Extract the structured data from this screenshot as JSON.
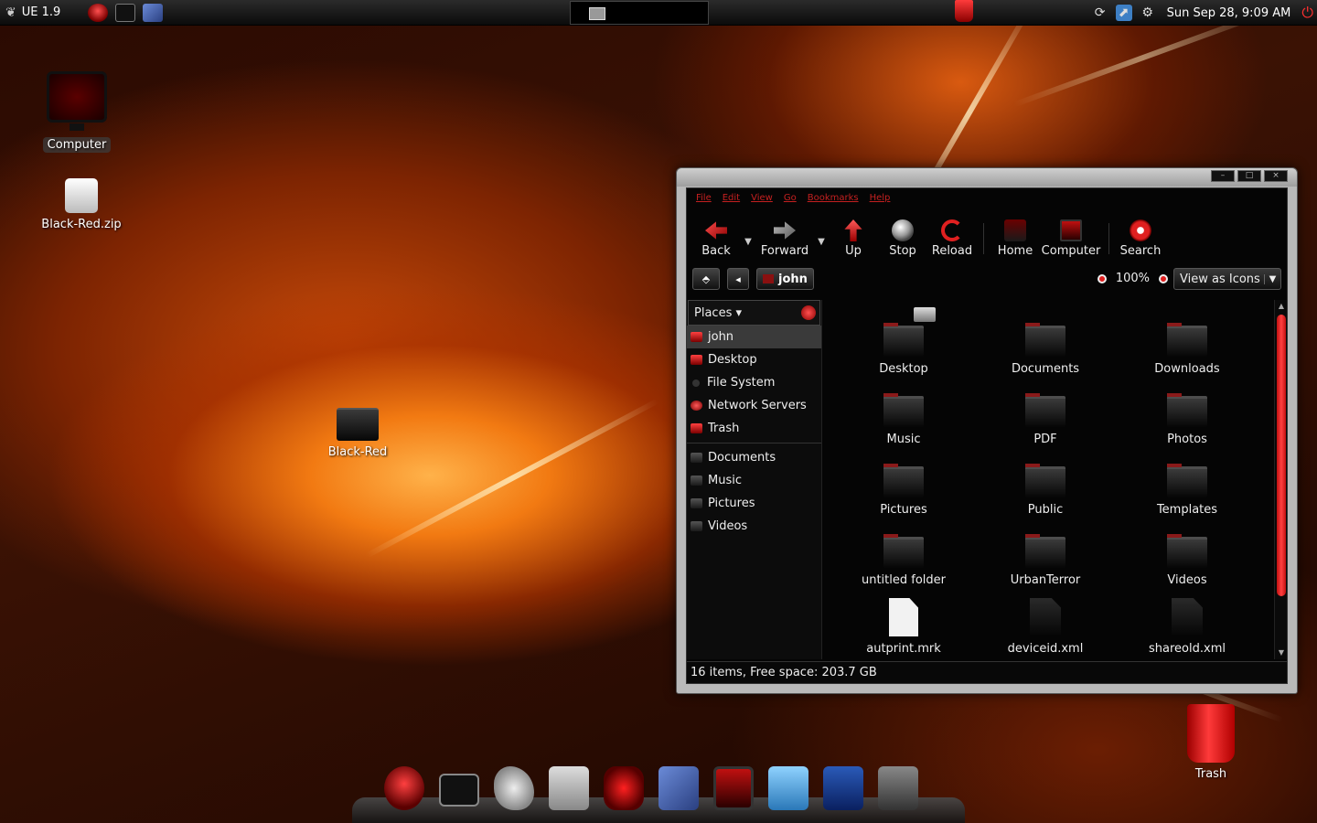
{
  "top_panel": {
    "app_menu_label": "UE 1.9",
    "clock": "Sun Sep 28,  9:09 AM"
  },
  "desktop": {
    "icons": [
      {
        "label": "Computer"
      },
      {
        "label": "Black-Red.zip"
      },
      {
        "label": "Black-Red"
      },
      {
        "label": "Trash"
      }
    ]
  },
  "file_manager": {
    "menu": [
      "File",
      "Edit",
      "View",
      "Go",
      "Bookmarks",
      "Help"
    ],
    "toolbar": {
      "back": "Back",
      "forward": "Forward",
      "up": "Up",
      "stop": "Stop",
      "reload": "Reload",
      "home": "Home",
      "computer": "Computer",
      "search": "Search"
    },
    "location": {
      "path_button": "john",
      "zoom": "100%",
      "view_mode": "View as Icons"
    },
    "sidebar": {
      "header": "Places",
      "places": [
        "john",
        "Desktop",
        "File System",
        "Network Servers",
        "Trash"
      ],
      "bookmarks": [
        "Documents",
        "Music",
        "Pictures",
        "Videos"
      ]
    },
    "items": [
      {
        "label": "Desktop",
        "kind": "folder"
      },
      {
        "label": "Documents",
        "kind": "folder"
      },
      {
        "label": "Downloads",
        "kind": "folder"
      },
      {
        "label": "Music",
        "kind": "folder"
      },
      {
        "label": "PDF",
        "kind": "folder"
      },
      {
        "label": "Photos",
        "kind": "folder"
      },
      {
        "label": "Pictures",
        "kind": "folder"
      },
      {
        "label": "Public",
        "kind": "folder"
      },
      {
        "label": "Templates",
        "kind": "folder"
      },
      {
        "label": "untitled folder",
        "kind": "folder"
      },
      {
        "label": "UrbanTerror",
        "kind": "folder"
      },
      {
        "label": "Videos",
        "kind": "folder"
      },
      {
        "label": "autprint.mrk",
        "kind": "document"
      },
      {
        "label": "deviceid.xml",
        "kind": "xml"
      },
      {
        "label": "shareold.xml",
        "kind": "xml"
      }
    ],
    "status": "16 items, Free space: 203.7 GB"
  }
}
